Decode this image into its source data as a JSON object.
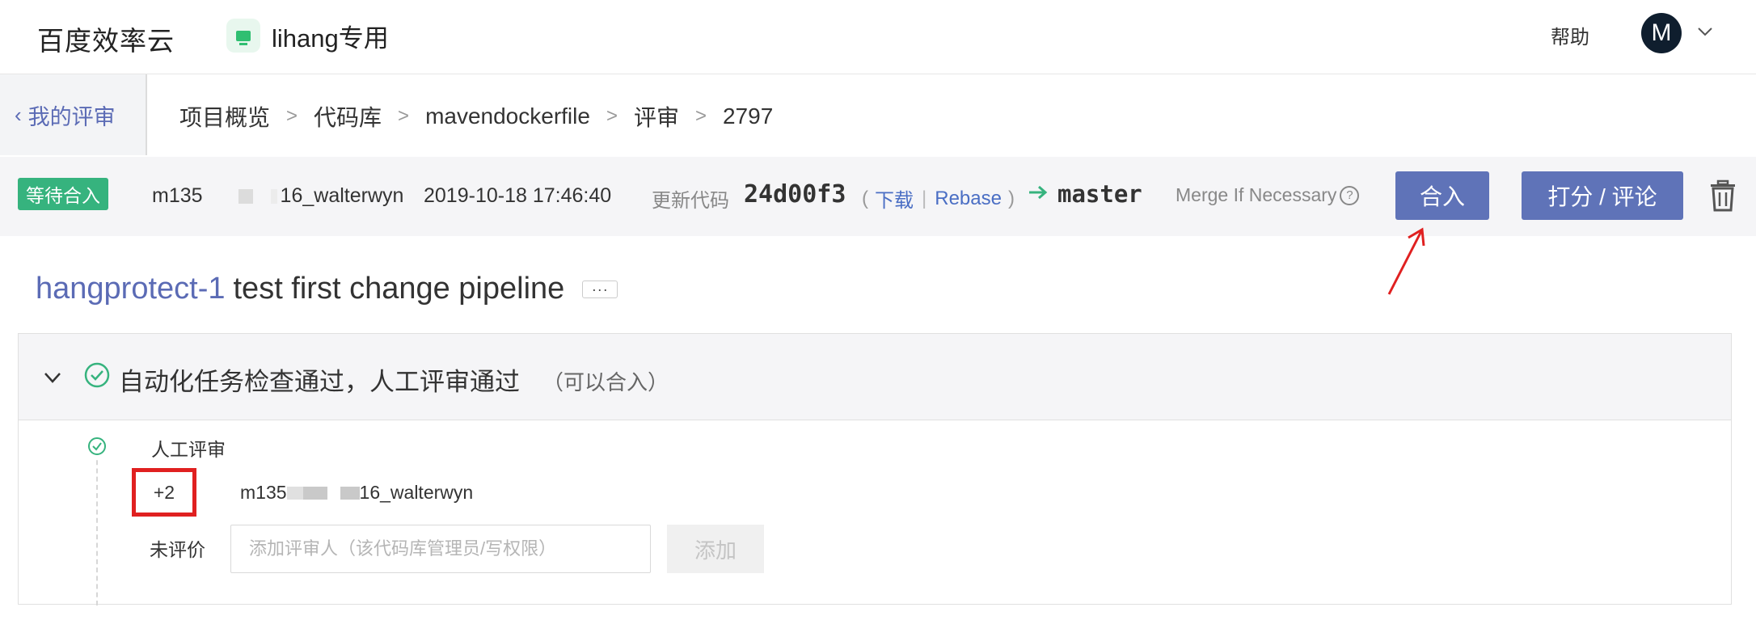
{
  "header": {
    "brand": "百度效率云",
    "project_name": "lihang专用",
    "help_label": "帮助",
    "avatar_initial": "M"
  },
  "nav": {
    "back_label": "我的评审",
    "breadcrumb": [
      "项目概览",
      "代码库",
      "mavendockerfile",
      "评审",
      "2797"
    ],
    "separator": ">"
  },
  "status_bar": {
    "badge": "等待合入",
    "author_prefix": "m135",
    "author_suffix": "16_walterwyn",
    "timestamp": "2019-10-18 17:46:40",
    "update_label": "更新代码",
    "commit_hash": "24d00f3",
    "download_link": "下载",
    "rebase_link": "Rebase",
    "target_branch": "master",
    "merge_strategy": "Merge If Necessary",
    "merge_button": "合入",
    "review_button": "打分 / 评论"
  },
  "change": {
    "id_prefix": "hangprotect-1",
    "title": "test first change pipeline",
    "more": "···"
  },
  "checks": {
    "summary": "自动化任务检查通过，人工评审通过",
    "note": "（可以合入）",
    "manual_review_title": "人工评审",
    "score": "+2",
    "reviewer_prefix": "m135",
    "reviewer_suffix": "16_walterwyn",
    "unrated_label": "未评价",
    "add_reviewer_placeholder": "添加评审人（该代码库管理员/写权限）",
    "add_button": "添加"
  },
  "colors": {
    "accent": "#5f73b8",
    "link": "#4a6ec4",
    "success": "#36b37e",
    "annotation_red": "#e02020"
  }
}
